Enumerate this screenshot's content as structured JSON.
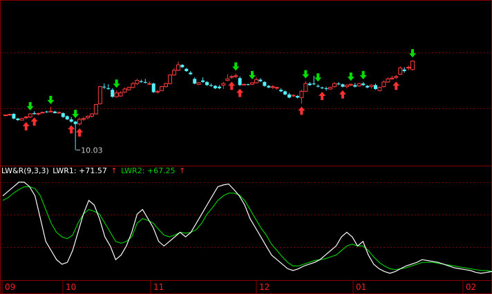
{
  "colors": {
    "background": "#000000",
    "frame": "#8b0000",
    "grid": "#7a0000",
    "up_candle": "#ff3c3c",
    "down_candle": "#54f0ff",
    "buy_arrow": "#ff3030",
    "sell_arrow": "#00e000",
    "lwr1_line": "#ffffff",
    "lwr2_line": "#00c800",
    "axis_text": "#ff2020",
    "label_text": "#ffffff",
    "low_label_text": "#c8c8c8"
  },
  "indicator": {
    "name": "LW&R(9,3,3)",
    "lwr1_label": "LWR1: +71.57",
    "lwr1_arrow": "↑",
    "lwr2_label": "LWR2: +67.25",
    "lwr2_arrow": "↑"
  },
  "price_annotation": {
    "low_label": "10.03"
  },
  "x_axis_labels": [
    "09",
    "10",
    "11",
    "12",
    "01",
    "02"
  ],
  "chart_data": [
    {
      "type": "candlestick",
      "title": "",
      "description_note": "",
      "candles": [
        [
          12.25,
          12.3,
          12.2,
          12.28
        ],
        [
          12.3,
          12.35,
          12.22,
          12.32
        ],
        [
          12.35,
          12.4,
          12.0,
          12.05
        ],
        [
          12.05,
          12.1,
          11.9,
          11.95
        ],
        [
          11.95,
          12.1,
          11.92,
          12.05
        ],
        [
          12.1,
          12.22,
          12.0,
          12.15
        ],
        [
          12.15,
          12.4,
          12.08,
          12.35
        ],
        [
          12.4,
          12.52,
          12.3,
          12.34
        ],
        [
          12.35,
          12.42,
          12.25,
          12.38
        ],
        [
          12.45,
          12.5,
          12.4,
          12.45
        ],
        [
          12.5,
          12.55,
          12.42,
          12.48
        ],
        [
          12.5,
          12.8,
          12.45,
          12.52
        ],
        [
          12.5,
          12.55,
          12.38,
          12.4
        ],
        [
          12.4,
          12.5,
          12.36,
          12.45
        ],
        [
          12.4,
          12.44,
          12.1,
          12.15
        ],
        [
          12.2,
          12.25,
          11.95,
          12.0
        ],
        [
          12.0,
          12.15,
          11.8,
          11.85
        ],
        [
          11.85,
          11.9,
          10.03,
          11.7
        ],
        [
          11.7,
          12.1,
          11.6,
          12.0
        ],
        [
          12.0,
          12.15,
          11.9,
          12.05
        ],
        [
          12.1,
          12.25,
          12.0,
          12.2
        ],
        [
          12.2,
          12.4,
          12.1,
          12.35
        ],
        [
          12.35,
          13.0,
          12.3,
          12.95
        ],
        [
          13.0,
          14.15,
          12.95,
          14.1
        ],
        [
          14.1,
          14.3,
          13.95,
          14.05
        ],
        [
          14.0,
          14.25,
          13.9,
          13.95
        ],
        [
          13.9,
          14.0,
          13.4,
          13.45
        ],
        [
          13.45,
          13.85,
          13.4,
          13.7
        ],
        [
          13.5,
          13.8,
          13.45,
          13.7
        ],
        [
          13.75,
          14.05,
          13.7,
          13.95
        ],
        [
          13.9,
          14.1,
          13.85,
          14.05
        ],
        [
          14.05,
          14.4,
          14.0,
          14.3
        ],
        [
          14.3,
          14.6,
          14.2,
          14.5
        ],
        [
          14.45,
          14.55,
          14.35,
          14.4
        ],
        [
          14.4,
          14.6,
          14.3,
          14.35
        ],
        [
          14.3,
          14.45,
          14.2,
          14.3
        ],
        [
          14.3,
          14.35,
          13.7,
          13.75
        ],
        [
          13.75,
          13.9,
          13.65,
          13.8
        ],
        [
          13.85,
          14.15,
          13.8,
          14.1
        ],
        [
          14.1,
          14.35,
          14.05,
          14.3
        ],
        [
          14.3,
          14.9,
          14.25,
          14.85
        ],
        [
          14.85,
          15.3,
          14.8,
          15.15
        ],
        [
          15.15,
          15.7,
          15.1,
          15.5
        ],
        [
          15.5,
          15.55,
          15.3,
          15.35
        ],
        [
          15.25,
          15.3,
          15.05,
          15.1
        ],
        [
          15.0,
          15.1,
          14.85,
          14.9
        ],
        [
          14.6,
          14.7,
          14.25,
          14.3
        ],
        [
          14.25,
          14.4,
          14.2,
          14.35
        ],
        [
          14.5,
          14.7,
          14.35,
          14.4
        ],
        [
          14.4,
          14.45,
          14.15,
          14.2
        ],
        [
          14.2,
          14.3,
          14.1,
          14.15
        ],
        [
          14.15,
          14.2,
          13.95,
          14.0
        ],
        [
          14.1,
          14.2,
          13.95,
          14.0
        ],
        [
          14.2,
          14.4,
          13.95,
          14.3
        ],
        [
          14.5,
          14.9,
          14.45,
          14.6
        ],
        [
          14.7,
          14.85,
          14.6,
          14.75
        ],
        [
          14.75,
          14.95,
          14.65,
          14.8
        ],
        [
          14.65,
          14.75,
          14.15,
          14.2
        ],
        [
          14.25,
          14.3,
          14.2,
          14.25
        ],
        [
          14.25,
          14.3,
          14.18,
          14.22
        ],
        [
          14.25,
          14.4,
          14.2,
          14.35
        ],
        [
          14.35,
          14.7,
          14.3,
          14.55
        ],
        [
          14.55,
          14.65,
          14.4,
          14.45
        ],
        [
          14.4,
          14.45,
          14.1,
          14.15
        ],
        [
          14.15,
          14.2,
          14.0,
          14.05
        ],
        [
          14.05,
          14.2,
          13.95,
          14.1
        ],
        [
          14.0,
          14.1,
          13.9,
          14.05
        ],
        [
          13.9,
          14.0,
          13.75,
          13.8
        ],
        [
          13.8,
          13.85,
          13.55,
          13.6
        ],
        [
          13.6,
          13.7,
          13.35,
          13.4
        ],
        [
          13.5,
          13.6,
          13.45,
          13.55
        ],
        [
          13.5,
          13.55,
          13.35,
          13.4
        ],
        [
          13.4,
          13.9,
          13.0,
          13.8
        ],
        [
          13.8,
          14.45,
          13.75,
          14.3
        ],
        [
          14.3,
          14.4,
          14.15,
          14.2
        ],
        [
          14.3,
          14.8,
          14.2,
          14.25
        ],
        [
          14.15,
          14.25,
          14.05,
          14.1
        ],
        [
          14.05,
          14.1,
          13.95,
          14.0
        ],
        [
          14.0,
          14.1,
          13.85,
          13.95
        ],
        [
          13.95,
          14.1,
          13.9,
          14.05
        ],
        [
          14.1,
          14.4,
          14.05,
          14.3
        ],
        [
          14.3,
          14.4,
          14.2,
          14.25
        ],
        [
          14.25,
          14.3,
          14.05,
          14.1
        ],
        [
          14.1,
          14.25,
          14.0,
          14.2
        ],
        [
          14.2,
          14.3,
          14.15,
          14.25
        ],
        [
          14.2,
          14.35,
          14.05,
          14.1
        ],
        [
          14.15,
          14.35,
          14.1,
          14.3
        ],
        [
          14.3,
          14.4,
          14.15,
          14.2
        ],
        [
          14.15,
          14.2,
          14.0,
          14.05
        ],
        [
          14.1,
          14.25,
          14.0,
          14.2
        ],
        [
          14.2,
          14.3,
          13.9,
          13.95
        ],
        [
          13.85,
          14.1,
          13.8,
          14.05
        ],
        [
          14.1,
          14.5,
          14.05,
          14.4
        ],
        [
          14.4,
          14.7,
          14.35,
          14.6
        ],
        [
          14.6,
          14.8,
          14.55,
          14.65
        ],
        [
          14.7,
          14.85,
          14.6,
          14.75
        ],
        [
          14.9,
          15.4,
          14.85,
          15.3
        ],
        [
          15.2,
          15.35,
          15.0,
          15.1
        ],
        [
          15.3,
          15.45,
          15.15,
          15.35
        ],
        [
          15.2,
          15.8,
          15.15,
          15.75
        ]
      ],
      "buy_signals": [
        5,
        7,
        16,
        18,
        55,
        57,
        72,
        77,
        82,
        95
      ],
      "sell_signals": [
        6,
        11,
        17,
        27,
        56,
        60,
        73,
        76,
        84,
        87,
        99
      ],
      "low_label_index": 17
    },
    {
      "type": "line",
      "title": "",
      "xlabel": "",
      "ylabel": "",
      "ylim": [
        0,
        100
      ],
      "series": [
        {
          "name": "LWR1",
          "values": [
            85,
            90,
            95,
            100,
            100,
            95,
            85,
            60,
            35,
            25,
            15,
            10,
            12,
            25,
            45,
            65,
            80,
            75,
            60,
            40,
            30,
            15,
            20,
            30,
            45,
            65,
            70,
            60,
            50,
            35,
            30,
            35,
            40,
            45,
            40,
            45,
            55,
            65,
            75,
            85,
            95,
            97,
            98,
            92,
            85,
            75,
            60,
            50,
            40,
            30,
            20,
            15,
            10,
            5,
            3,
            5,
            8,
            10,
            12,
            15,
            20,
            25,
            30,
            40,
            45,
            40,
            30,
            35,
            20,
            10,
            5,
            2,
            0,
            2,
            5,
            8,
            10,
            12,
            15,
            14,
            13,
            12,
            10,
            8,
            6,
            5,
            4,
            3,
            1,
            0,
            1,
            2
          ]
        },
        {
          "name": "LWR2",
          "values": [
            80,
            83,
            88,
            92,
            95,
            95,
            93,
            85,
            70,
            55,
            45,
            40,
            38,
            42,
            55,
            65,
            70,
            68,
            65,
            55,
            45,
            35,
            33,
            35,
            40,
            55,
            60,
            58,
            55,
            48,
            42,
            40,
            42,
            45,
            44,
            45,
            48,
            55,
            65,
            72,
            80,
            85,
            88,
            88,
            86,
            80,
            70,
            60,
            50,
            42,
            32,
            25,
            18,
            12,
            8,
            8,
            10,
            12,
            14,
            15,
            16,
            18,
            20,
            25,
            30,
            32,
            30,
            30,
            25,
            18,
            12,
            8,
            5,
            4,
            5,
            6,
            8,
            10,
            12,
            12,
            12,
            11,
            10,
            9,
            8,
            7,
            6,
            5,
            4,
            3,
            3,
            2
          ]
        }
      ]
    }
  ]
}
